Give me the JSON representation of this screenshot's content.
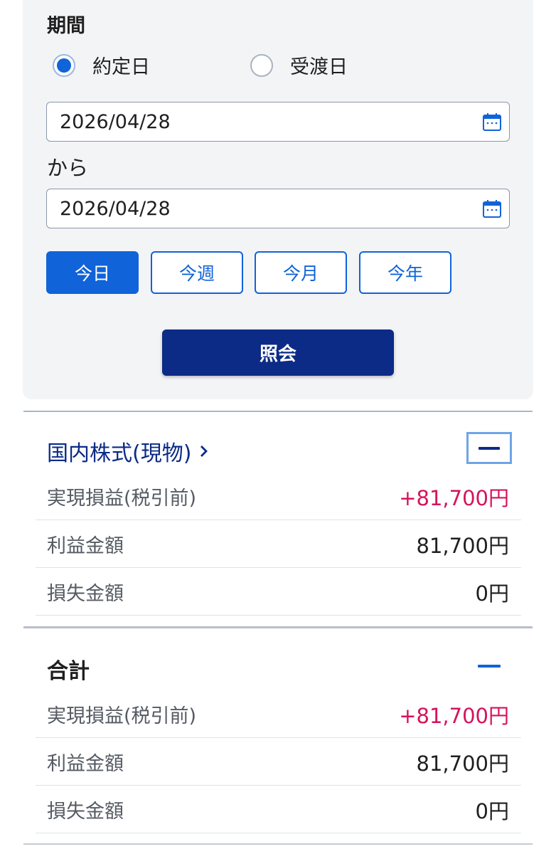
{
  "period": {
    "title": "期間",
    "radio_options": [
      {
        "label": "約定日",
        "selected": true
      },
      {
        "label": "受渡日",
        "selected": false
      }
    ],
    "start_date": "2026/04/28",
    "from_label": "から",
    "end_date": "2026/04/28",
    "quick_buttons": [
      {
        "label": "今日",
        "active": true
      },
      {
        "label": "今週",
        "active": false
      },
      {
        "label": "今月",
        "active": false
      },
      {
        "label": "今年",
        "active": false
      }
    ],
    "query_button": "照会"
  },
  "sections": [
    {
      "title": "国内株式(現物)",
      "collapse_icon": "minus-icon",
      "rows": [
        {
          "label": "実現損益(税引前)",
          "value": "+81,700円"
        },
        {
          "label": "利益金額",
          "value": "81,700円"
        },
        {
          "label": "損失金額",
          "value": "0円"
        }
      ]
    },
    {
      "title": "合計",
      "collapse_icon": "minus-icon",
      "rows": [
        {
          "label": "実現損益(税引前)",
          "value": "+81,700円"
        },
        {
          "label": "利益金額",
          "value": "81,700円"
        },
        {
          "label": "損失金額",
          "value": "0円"
        }
      ]
    }
  ],
  "colors": {
    "accent_blue": "#1063d8",
    "navy": "#0b2b86",
    "profit_red": "#d6135b"
  }
}
